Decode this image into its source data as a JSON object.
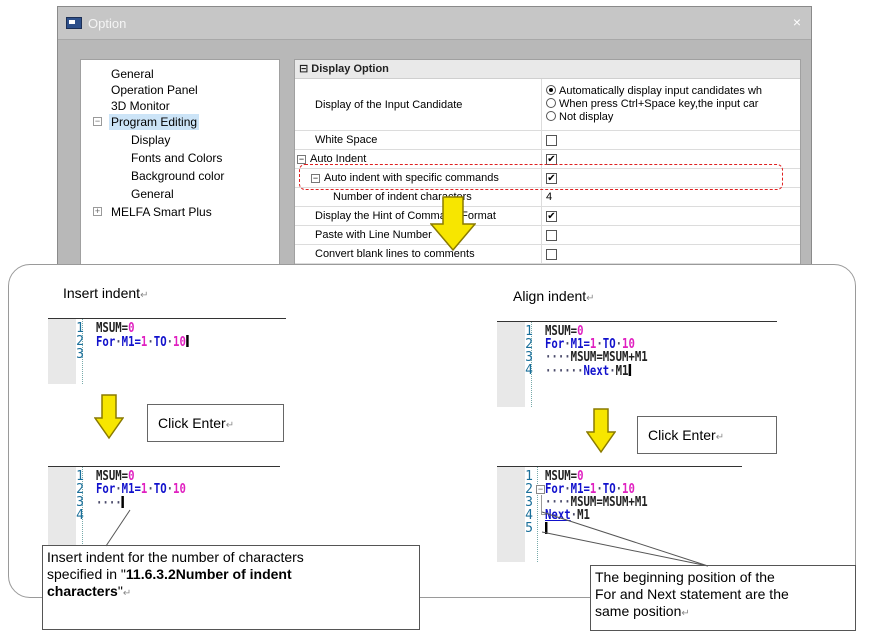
{
  "dialog": {
    "title": "Option",
    "close_symbol": "×",
    "tree": {
      "items": [
        {
          "label": "General",
          "level": 0
        },
        {
          "label": "Operation Panel",
          "level": 0
        },
        {
          "label": "3D Monitor",
          "level": 0
        },
        {
          "label": "Program Editing",
          "level": 0,
          "expander": "−",
          "selected": true
        },
        {
          "label": "Display",
          "level": 1
        },
        {
          "label": "Fonts and Colors",
          "level": 1
        },
        {
          "label": "Background color",
          "level": 1
        },
        {
          "label": "General",
          "level": 1
        },
        {
          "label": "MELFA Smart Plus",
          "level": 0,
          "expander": "+"
        }
      ]
    },
    "grid": {
      "section_symbol": "⊟",
      "section_title": "Display Option",
      "rows": {
        "input_candidate": {
          "name": "Display of the Input Candidate",
          "options": [
            "Automatically display input candidates wh",
            "When press Ctrl+Space key,the input car",
            "Not display"
          ],
          "selected_index": 0
        },
        "white_space": {
          "name": "White Space",
          "checked": false
        },
        "auto_indent": {
          "name": "Auto Indent",
          "checked": true
        },
        "auto_indent_specific": {
          "name": "Auto indent with specific commands",
          "checked": true
        },
        "indent_chars": {
          "name": "Number of indent characters",
          "value": "4"
        },
        "hint_format": {
          "name": "Display the Hint of Command Format",
          "checked": true
        },
        "paste_line": {
          "name": "Paste with Line Number",
          "checked": false
        },
        "convert_blank": {
          "name": "Convert blank lines to comments",
          "checked": false
        }
      },
      "check_mark": "✔"
    }
  },
  "panel": {
    "return_mark": "↵",
    "insert_heading": "Insert indent",
    "align_heading": "Align indent",
    "click_enter_label": "Click Enter",
    "note_insert": {
      "line1": "Insert indent for the number of characters",
      "line2_pre": "specified in \"",
      "line2_bold": "11.6.3.2Number of indent",
      "line3_bold": "characters",
      "line3_post": "\""
    },
    "note_align": {
      "line1": "The beginning position of the",
      "line2": "For and Next statement are the",
      "line3": "same position"
    },
    "code": {
      "l_msum": "MSUM=",
      "l_zero": "0",
      "kw_for": "For",
      "dot": "·",
      "var_m1": "M1",
      "eq": "=",
      "n1": "1",
      "kw_to": "TO",
      "n10": "10",
      "indent_dots": "····",
      "indent_dots6": "······",
      "msum_expr": "MSUM=MSUM+M1",
      "kw_next": "Next",
      "line_numbers_3": [
        "1",
        "2",
        "3"
      ],
      "line_numbers_4": [
        "1",
        "2",
        "3",
        "4"
      ],
      "line_numbers_5": [
        "1",
        "2",
        "3",
        "4",
        "5"
      ]
    }
  }
}
